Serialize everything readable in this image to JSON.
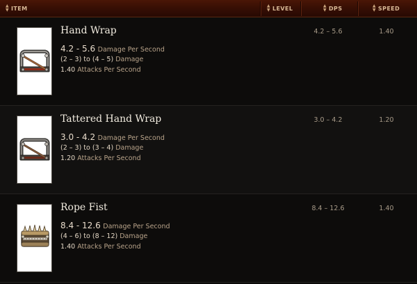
{
  "header": {
    "item_label": "ITEM",
    "level_label": "LEVEL",
    "dps_label": "DPS",
    "speed_label": "SPEED"
  },
  "rows": [
    {
      "name": "Hand Wrap",
      "dps_value": "4.2 - 5.6",
      "dps_label": "Damage Per Second",
      "damage_range": "(2 – 3) to (4 – 5)",
      "damage_label": "Damage",
      "aps_value": "1.40",
      "aps_label": "Attacks Per Second",
      "dps_col": "4.2 – 5.6",
      "speed_col": "1.40",
      "icon": "hand-wrap-icon"
    },
    {
      "name": "Tattered Hand Wrap",
      "dps_value": "3.0 - 4.2",
      "dps_label": "Damage Per Second",
      "damage_range": "(2 – 3) to (3 – 4)",
      "damage_label": "Damage",
      "aps_value": "1.20",
      "aps_label": "Attacks Per Second",
      "dps_col": "3.0 – 4.2",
      "speed_col": "1.20",
      "icon": "tattered-hand-wrap-icon"
    },
    {
      "name": "Rope Fist",
      "dps_value": "8.4 - 12.6",
      "dps_label": "Damage Per Second",
      "damage_range": "(4 – 6) to (8 – 12)",
      "damage_label": "Damage",
      "aps_value": "1.40",
      "aps_label": "Attacks Per Second",
      "dps_col": "8.4 – 12.6",
      "speed_col": "1.40",
      "icon": "rope-fist-icon"
    }
  ],
  "colors": {
    "header_bg": "#3a0f04",
    "header_text": "#d9b996",
    "row_bg": "#0d0c0b",
    "item_name": "#f1ebdf",
    "stat_label": "#b8a38a"
  }
}
